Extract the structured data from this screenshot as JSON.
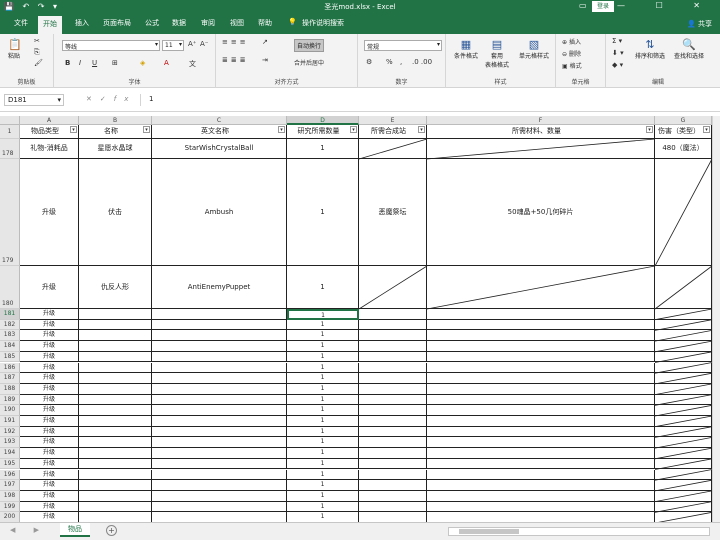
{
  "app": {
    "title": "圣光mod.xlsx  -  Excel",
    "login_label": "登录",
    "share_label": "共享",
    "qa_icons": "💾 ↶ ↷ ▾",
    "win_controls": "▭ — ☐ ✕"
  },
  "tabs": [
    "文件",
    "开始",
    "插入",
    "页面布局",
    "公式",
    "数据",
    "审阅",
    "视图",
    "帮助",
    "操作说明搜索"
  ],
  "active_tab": "开始",
  "ribbon": {
    "clipboard": {
      "label": "剪贴板",
      "paste": "粘贴"
    },
    "font": {
      "label": "字体",
      "name": "等线",
      "size": "11",
      "bold": "B",
      "italic": "I",
      "underline": "U"
    },
    "align": {
      "label": "对齐方式",
      "wrap": "自动换行",
      "merge": "合并后居中"
    },
    "number": {
      "label": "数字",
      "format": "常规",
      "percent": "%",
      "comma": ","
    },
    "styles": {
      "label": "样式",
      "cond": "条件格式",
      "table": "套用\n表格格式",
      "cell": "单元格样式"
    },
    "cells": {
      "label": "单元格",
      "insert": "插入",
      "delete": "删除",
      "format": "格式"
    },
    "edit": {
      "label": "编辑",
      "sort": "排序和筛选",
      "find": "查找和选择"
    }
  },
  "formula_bar": {
    "name_box": "D181",
    "cancel": "✕",
    "enter": "✓",
    "fx": "fx",
    "value": "1"
  },
  "columns": [
    {
      "letter": "A",
      "header": "物品类型"
    },
    {
      "letter": "B",
      "header": "名称"
    },
    {
      "letter": "C",
      "header": "英文名称"
    },
    {
      "letter": "D",
      "header": "研究所需数量"
    },
    {
      "letter": "E",
      "header": "所需合成站"
    },
    {
      "letter": "F",
      "header": "所需材料、数量"
    },
    {
      "letter": "G",
      "header": "伤害（类型）"
    }
  ],
  "selected_column": "D",
  "selected_row": "181",
  "big_rows": [
    {
      "row": "178",
      "a": "礼物-消耗品",
      "b": "星愿水晶球",
      "c": "StarWishCrystalBall",
      "d": "1",
      "e": "",
      "f": "",
      "g": "480（魔法）"
    },
    {
      "row": "179",
      "a": "升级",
      "b": "伏击",
      "c": "Ambush",
      "d": "1",
      "e": "恶魔祭坛",
      "f": "50魂晶+50几何碎片",
      "g": ""
    },
    {
      "row": "180",
      "a": "升级",
      "b": "仇反人形",
      "c": "AntiEnemyPuppet",
      "d": "1",
      "e": "",
      "f": "",
      "g": ""
    }
  ],
  "small_rows": [
    {
      "row": "181",
      "a": "升级",
      "d": "1"
    },
    {
      "row": "182",
      "a": "升级",
      "d": "1"
    },
    {
      "row": "183",
      "a": "升级",
      "d": "1"
    },
    {
      "row": "184",
      "a": "升级",
      "d": "1"
    },
    {
      "row": "185",
      "a": "升级",
      "d": "1"
    },
    {
      "row": "186",
      "a": "升级",
      "d": "1"
    },
    {
      "row": "187",
      "a": "升级",
      "d": "1"
    },
    {
      "row": "188",
      "a": "升级",
      "d": "1"
    },
    {
      "row": "189",
      "a": "升级",
      "d": "1"
    },
    {
      "row": "190",
      "a": "升级",
      "d": "1"
    },
    {
      "row": "191",
      "a": "升级",
      "d": "1"
    },
    {
      "row": "192",
      "a": "升级",
      "d": "1"
    },
    {
      "row": "193",
      "a": "升级",
      "d": "1"
    },
    {
      "row": "194",
      "a": "升级",
      "d": "1"
    },
    {
      "row": "195",
      "a": "升级",
      "d": "1"
    },
    {
      "row": "196",
      "a": "升级",
      "d": "1"
    },
    {
      "row": "197",
      "a": "升级",
      "d": "1"
    },
    {
      "row": "198",
      "a": "升级",
      "d": "1"
    },
    {
      "row": "199",
      "a": "升级",
      "d": "1"
    },
    {
      "row": "200",
      "a": "升级",
      "d": "1"
    }
  ],
  "sheet_tab": "物品",
  "sheet_nav": "◀ ▶"
}
